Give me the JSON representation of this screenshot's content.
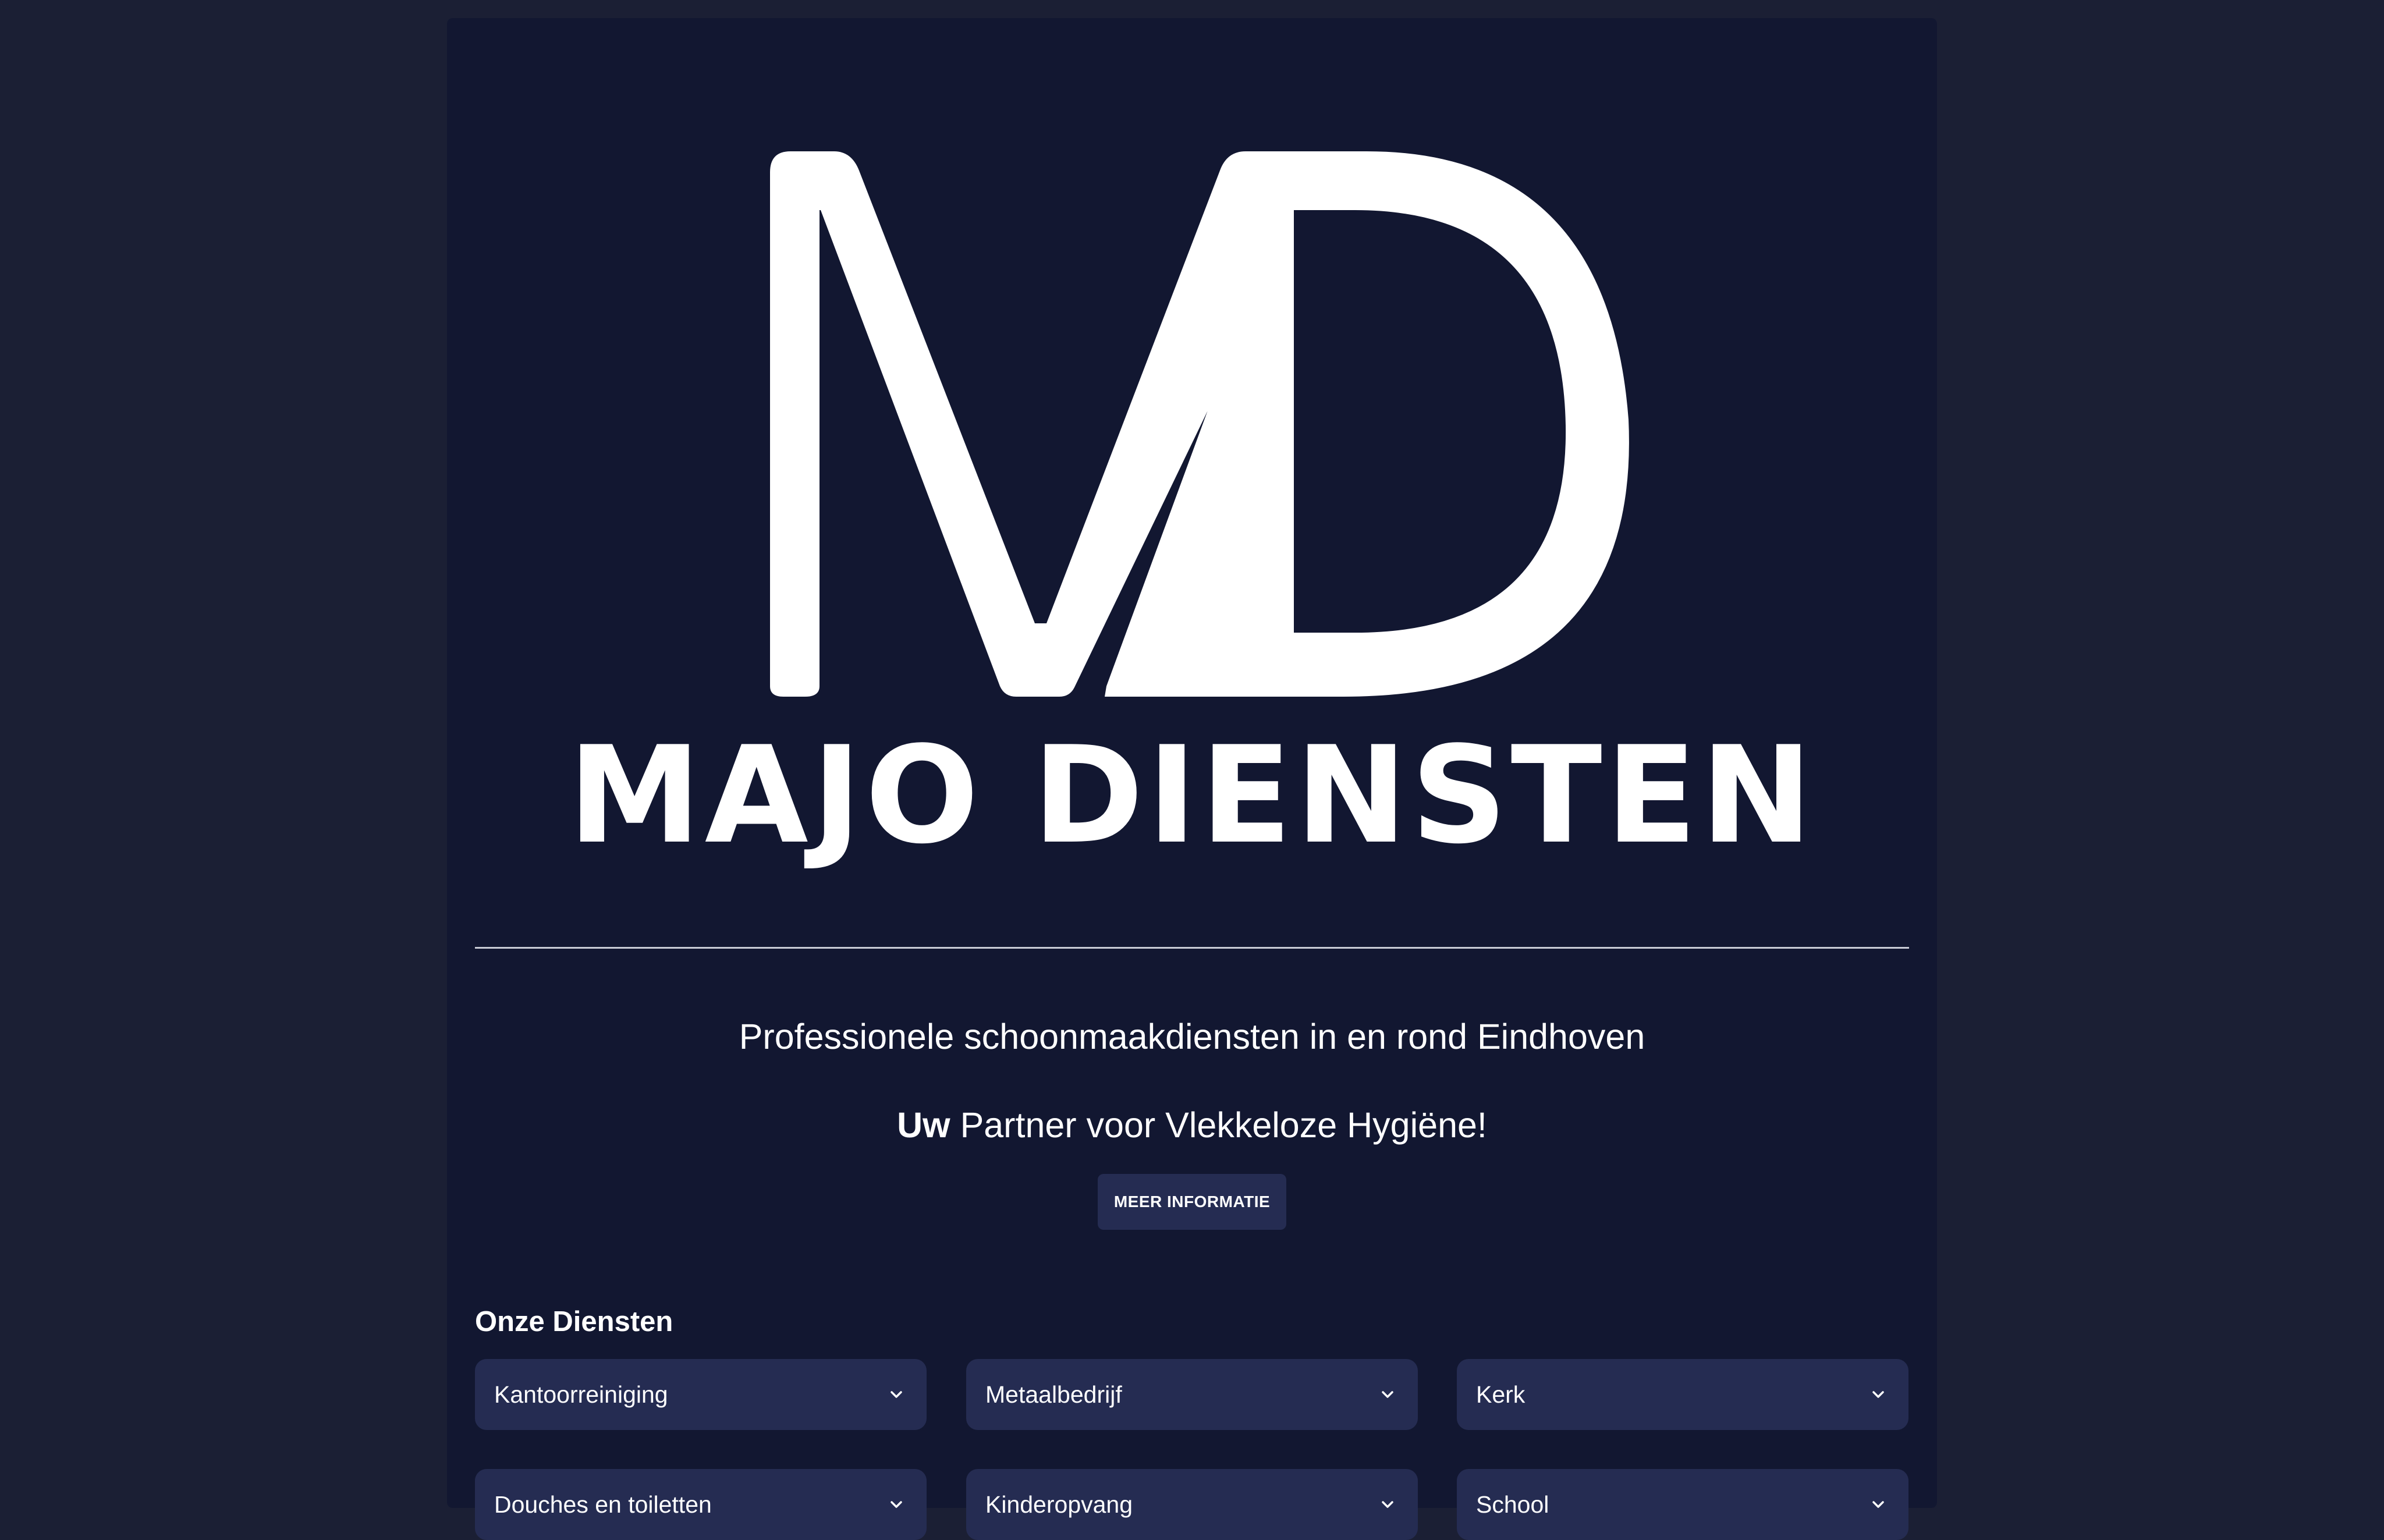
{
  "brand": {
    "logo_text": "MAJO DIENSTEN",
    "monogram": "MD"
  },
  "hero": {
    "subtitle": "Professionele schoonmaakdiensten in en rond Eindhoven",
    "tagline_strong": "Uw",
    "tagline_rest": " Partner voor Vlekkeloze Hygiëne!",
    "button_label": "MEER INFORMATIE"
  },
  "services": {
    "heading": "Onze Diensten",
    "items": [
      {
        "label": "Kantoorreiniging",
        "icon": "chevron-down-icon"
      },
      {
        "label": "Metaalbedrijf",
        "icon": "chevron-down-icon"
      },
      {
        "label": "Kerk",
        "icon": "chevron-down-icon"
      },
      {
        "label": "Douches en toiletten",
        "icon": "chevron-down-icon"
      },
      {
        "label": "Kinderopvang",
        "icon": "chevron-down-icon"
      },
      {
        "label": "School",
        "icon": "chevron-down-icon"
      }
    ]
  },
  "colors": {
    "page_background": "#1b1f34",
    "panel_background": "#121731",
    "card_background": "#252c52",
    "text": "#ffffff"
  }
}
